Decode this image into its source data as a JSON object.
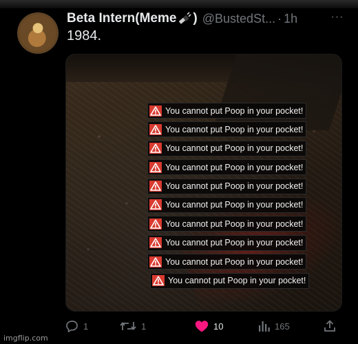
{
  "tweet": {
    "display_name": "Beta Intern(Meme",
    "display_name_close": ")",
    "name_badge_icon": "electric-plug-emoji",
    "handle": "@BustedSt...",
    "separator": "·",
    "time": "1h",
    "more_label": "···",
    "text": "1984."
  },
  "media": {
    "notifications": [
      {
        "icon": "warning-icon",
        "text": "You cannot put Poop in your pocket!"
      },
      {
        "icon": "warning-icon",
        "text": "You cannot put Poop in your pocket!"
      },
      {
        "icon": "warning-icon",
        "text": "You cannot put Poop in your pocket!"
      },
      {
        "icon": "warning-icon",
        "text": "You cannot put Poop in your pocket!"
      },
      {
        "icon": "warning-icon",
        "text": "You cannot put Poop in your pocket!"
      },
      {
        "icon": "warning-icon",
        "text": "You cannot put Poop in your pocket!"
      },
      {
        "icon": "warning-icon",
        "text": "You cannot put Poop in your pocket!"
      },
      {
        "icon": "warning-icon",
        "text": "You cannot put Poop in your pocket!"
      },
      {
        "icon": "warning-icon",
        "text": "You cannot put Poop in your pocket!"
      },
      {
        "icon": "warning-icon",
        "text": "You cannot put Poop in your pocket!"
      }
    ],
    "warning_color": "#d93b30"
  },
  "actions": {
    "reply_count": "1",
    "retweet_count": "1",
    "like_count": "10",
    "views_count": "165",
    "like_color": "#f91880",
    "retweet_color": "#00ba7c"
  },
  "watermark": "imgflip.com"
}
